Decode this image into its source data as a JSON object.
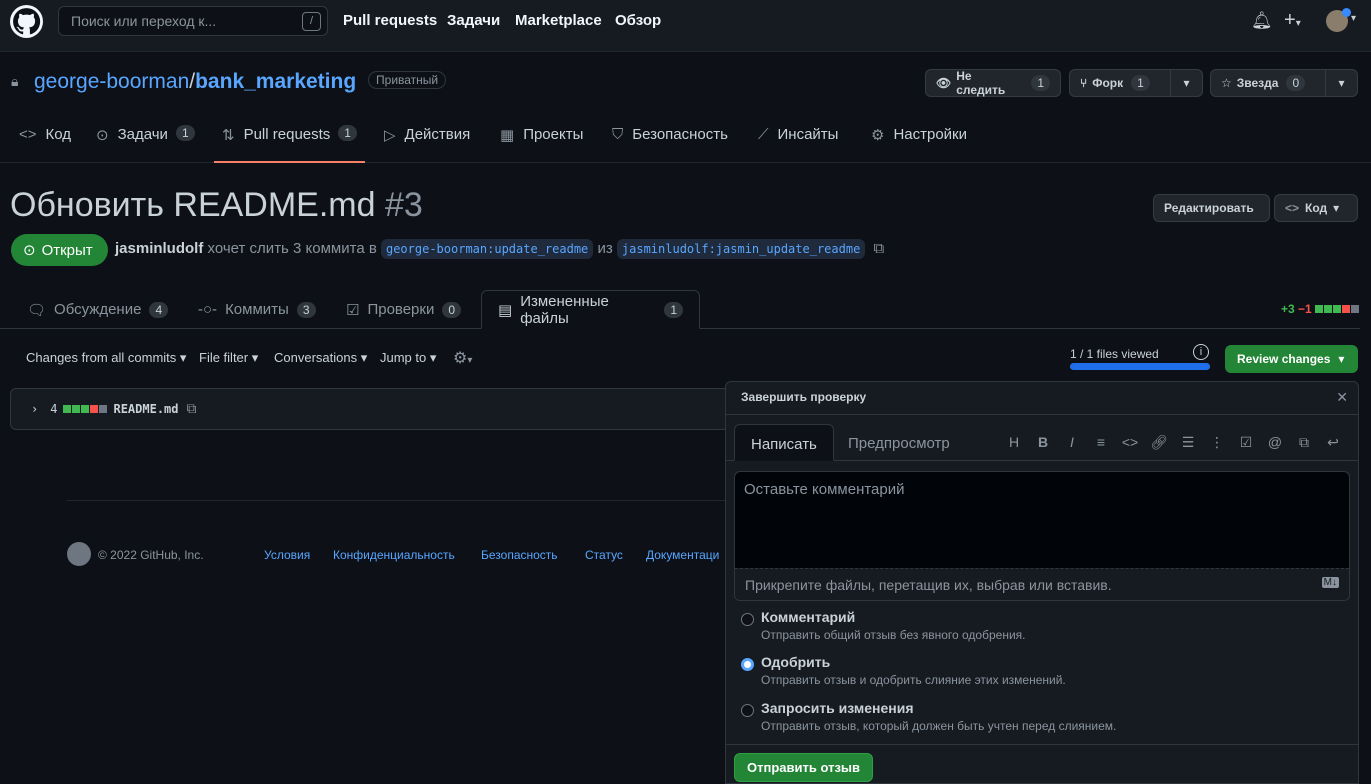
{
  "header": {
    "search_placeholder": "Поиск или переход к...",
    "slash": "/",
    "nav": [
      "Pull requests",
      "Задачи",
      "Marketplace",
      "Обзор"
    ]
  },
  "repo": {
    "owner": "george-boorman",
    "sep": "/",
    "name": "bank_marketing",
    "visibility": "Приватный",
    "watch": {
      "label": "Не следить",
      "count": "1"
    },
    "fork": {
      "label": "Форк",
      "count": "1"
    },
    "star": {
      "label": "Звезда",
      "count": "0"
    }
  },
  "tabs": [
    {
      "label": "Код"
    },
    {
      "label": "Задачи",
      "count": "1"
    },
    {
      "label": "Pull requests",
      "count": "1"
    },
    {
      "label": "Действия"
    },
    {
      "label": "Проекты"
    },
    {
      "label": "Безопасность"
    },
    {
      "label": "Инсайты"
    },
    {
      "label": "Настройки"
    }
  ],
  "pr": {
    "title": "Обновить README.md",
    "number": "#3",
    "state": "Открыт",
    "author": "jasminludolf",
    "action": "хочет слить 3 коммита в",
    "base": "george-boorman:update_readme",
    "from_word": "из",
    "head": "jasminludolf:jasmin_update_readme",
    "edit_btn": "Редактировать",
    "code_btn": "Код"
  },
  "prtabs": [
    {
      "label": "Обсуждение",
      "count": "4"
    },
    {
      "label": "Коммиты",
      "count": "3"
    },
    {
      "label": "Проверки",
      "count": "0"
    },
    {
      "label": "Измененные файлы",
      "count": "1"
    }
  ],
  "diffstat": {
    "add": "+3",
    "del": "−1"
  },
  "toolbar": {
    "changes": "Changes from all commits",
    "filter": "File filter",
    "conversations": "Conversations",
    "jump": "Jump to",
    "viewed": "1 / 1 files viewed",
    "viewed_fraction": 1,
    "review": "Review changes"
  },
  "file": {
    "changes": "4",
    "name": "README.md"
  },
  "footer": {
    "copyright": "© 2022 GitHub, Inc.",
    "links": [
      "Условия",
      "Конфиденциальность",
      "Безопасность",
      "Статус",
      "Документаци"
    ]
  },
  "review": {
    "title": "Завершить проверку",
    "write": "Написать",
    "preview": "Предпросмотр",
    "placeholder": "Оставьте комментарий",
    "attach": "Прикрепите файлы, перетащив их, выбрав или вставив.",
    "options": [
      {
        "label": "Комментарий",
        "desc": "Отправить общий отзыв без явного одобрения."
      },
      {
        "label": "Одобрить",
        "desc": "Отправить отзыв и одобрить слияние этих изменений."
      },
      {
        "label": "Запросить изменения",
        "desc": "Отправить отзыв, который должен быть учтен перед слиянием."
      }
    ],
    "selected": "Одобрить",
    "submit": "Отправить отзыв"
  }
}
